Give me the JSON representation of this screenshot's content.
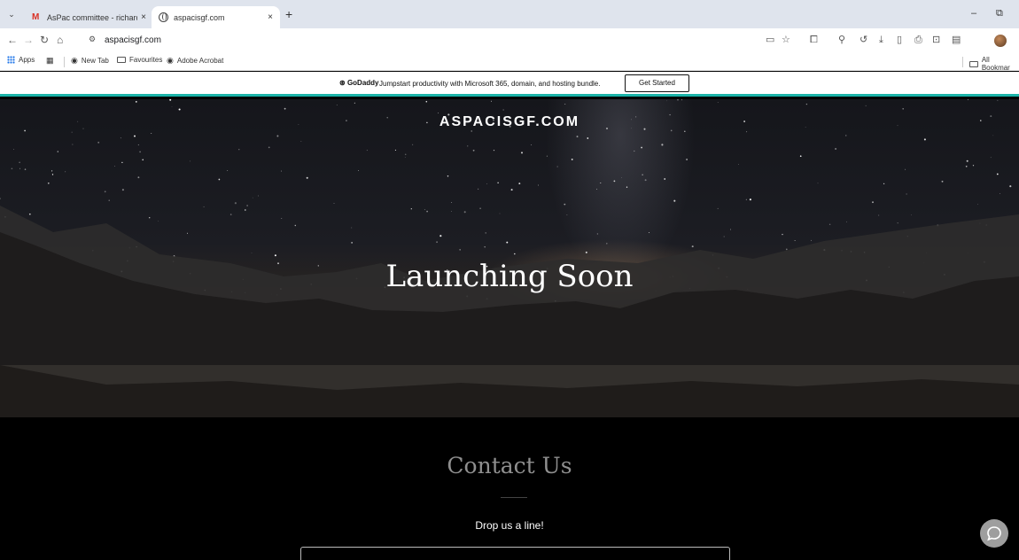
{
  "browser": {
    "tabs": [
      {
        "title": "AsPac committee - richard.stu",
        "active": false,
        "favicon": "gmail-icon"
      },
      {
        "title": "aspacisgf.com",
        "active": true,
        "favicon": "globe-icon"
      }
    ],
    "tab_close": "×",
    "new_tab": "+",
    "window_controls": {
      "minimize": "–",
      "restore": "⧉"
    },
    "url": "aspacisgf.com",
    "bookmarks": [
      {
        "label": "Apps",
        "icon": "apps-grid-icon"
      },
      {
        "label": "",
        "icon": "grid-icon"
      },
      {
        "label": "New Tab",
        "icon": "globe-icon"
      },
      {
        "label": "Favourites",
        "icon": "folder-icon"
      },
      {
        "label": "Adobe Acrobat",
        "icon": "globe-icon"
      }
    ],
    "all_bookmarks": "All Bookmar"
  },
  "banner": {
    "brand": "GoDaddy",
    "text": "Jumpstart productivity with Microsoft 365, domain, and hosting bundle.",
    "button": "Get Started",
    "accent": "#1bb3a8"
  },
  "hero": {
    "site_name": "ASPACISGF.COM",
    "title": "Launching Soon"
  },
  "contact": {
    "title": "Contact Us",
    "subtitle": "Drop us a line!"
  },
  "colors": {
    "tabstrip": "#dfe4ed",
    "chat_button": "#9e9e9e"
  }
}
